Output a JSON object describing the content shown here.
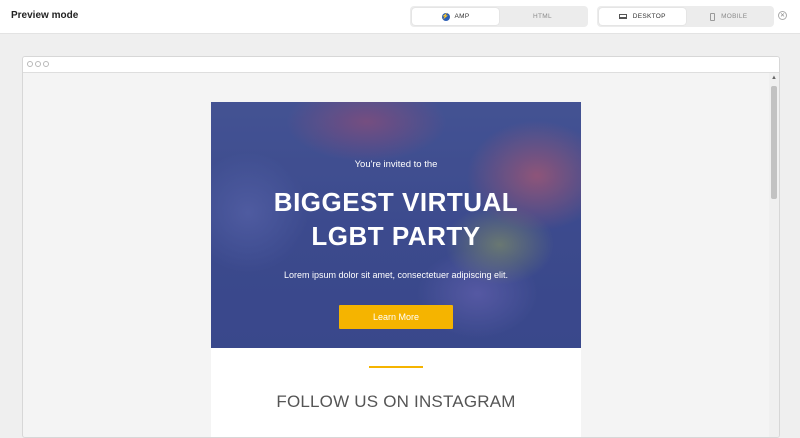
{
  "app": {
    "title": "Preview mode"
  },
  "mode_toggle": {
    "options": [
      "AMP",
      "HTML"
    ],
    "active": "AMP",
    "amp_icon_glyph": "⚡"
  },
  "device_toggle": {
    "options": [
      "DESKTOP",
      "MOBILE"
    ],
    "active": "DESKTOP"
  },
  "close": {
    "glyph": "✕"
  },
  "browser": {
    "scroll_up_glyph": "▲"
  },
  "email": {
    "hero": {
      "invite": "You're invited to the",
      "headline_line1": "BIGGEST VIRTUAL",
      "headline_line2": "LGBT PARTY",
      "body": "Lorem ipsum dolor sit amet, consectetuer adipiscing elit.",
      "cta": "Learn More"
    },
    "follow_title": "FOLLOW US ON INSTAGRAM"
  },
  "colors": {
    "accent": "#f5b400",
    "hero_base": "#3f4d8e",
    "amp_icon": "#2d5fb5"
  }
}
